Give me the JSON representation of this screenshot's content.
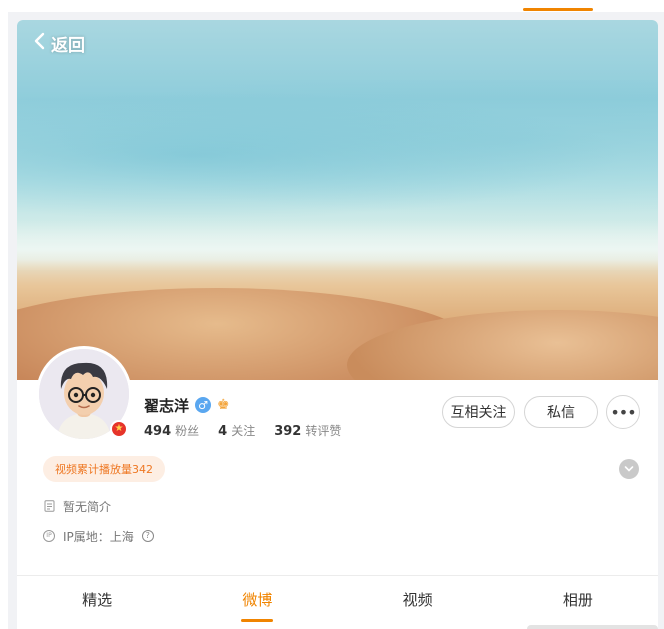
{
  "header": {
    "back_label": "返回"
  },
  "profile": {
    "name": "翟志洋",
    "stats": [
      {
        "value": "494",
        "label": "粉丝"
      },
      {
        "value": "4",
        "label": "关注"
      },
      {
        "value": "392",
        "label": "转评赞"
      }
    ],
    "actions": {
      "mutual_follow": "互相关注",
      "message": "私信",
      "more": "•••"
    },
    "play_count_tag": "视频累计播放量342",
    "bio": "暂无简介",
    "ip_location": "IP属地：上海"
  },
  "icons": {
    "back": "chevron-left-icon",
    "gender": "male-icon",
    "crown": "crown-icon",
    "verify": "verify-badge-icon",
    "expand": "chevron-down-icon",
    "bio": "document-icon",
    "ip": "ip-icon",
    "help": "question-icon"
  },
  "tabs": [
    {
      "label": "精选",
      "active": false
    },
    {
      "label": "微博",
      "active": true
    },
    {
      "label": "视频",
      "active": false
    },
    {
      "label": "相册",
      "active": false
    }
  ],
  "colors": {
    "accent": "#f08400",
    "tag_bg": "#fdeee3",
    "tag_text": "#ee7722",
    "gender": "#5aa7f0",
    "verify": "#e6342a"
  }
}
